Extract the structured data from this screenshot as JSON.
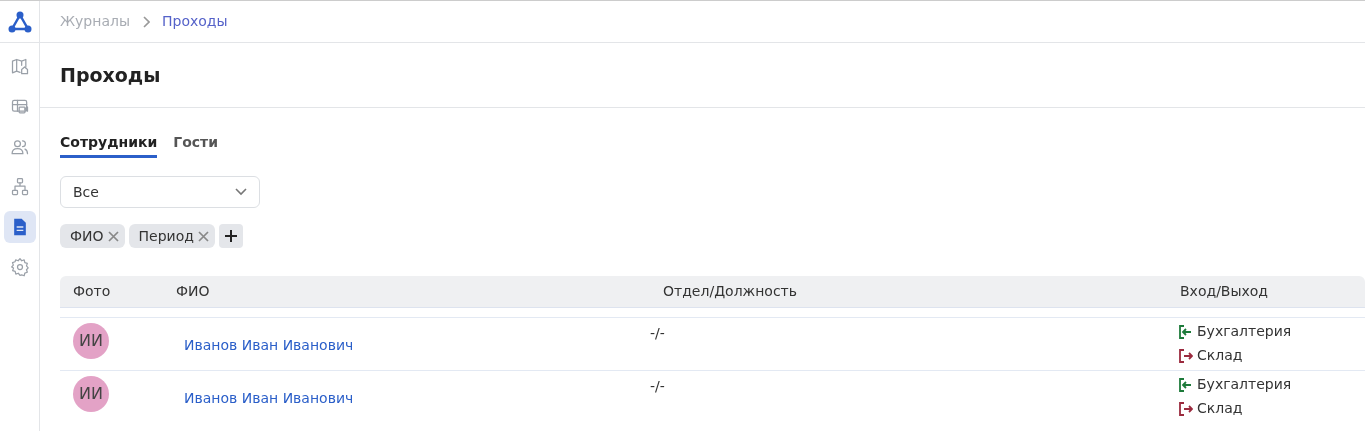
{
  "breadcrumbs": [
    {
      "label": "Журналы",
      "current": false
    },
    {
      "label": "Проходы",
      "current": true
    }
  ],
  "sidebar": {
    "items": [
      {
        "selected": false
      },
      {
        "selected": false
      },
      {
        "selected": false
      },
      {
        "selected": false
      },
      {
        "selected": true
      },
      {
        "selected": false
      }
    ]
  },
  "page_title": "Проходы",
  "tabs": [
    {
      "label": "Сотрудники",
      "selected": true
    },
    {
      "label": "Гости",
      "selected": false
    }
  ],
  "filter_select": {
    "value": "Все"
  },
  "filter_chips": [
    {
      "label": "ФИО"
    },
    {
      "label": "Период"
    }
  ],
  "table": {
    "columns": [
      "Фото",
      "ФИО",
      "Отдел/Должность",
      "Вход/Выход"
    ],
    "rows": [
      {
        "initials": "ИИ",
        "name": "Иванов Иван Иванович",
        "department": "-/-",
        "events": [
          {
            "kind": "in",
            "place": "Бухгалтерия"
          },
          {
            "kind": "out",
            "place": "Склад"
          }
        ]
      },
      {
        "initials": "ИИ",
        "name": "Иванов Иван Иванович",
        "department": "-/-",
        "events": [
          {
            "kind": "in",
            "place": "Бухгалтерия"
          },
          {
            "kind": "out",
            "place": "Склад"
          }
        ]
      }
    ]
  }
}
